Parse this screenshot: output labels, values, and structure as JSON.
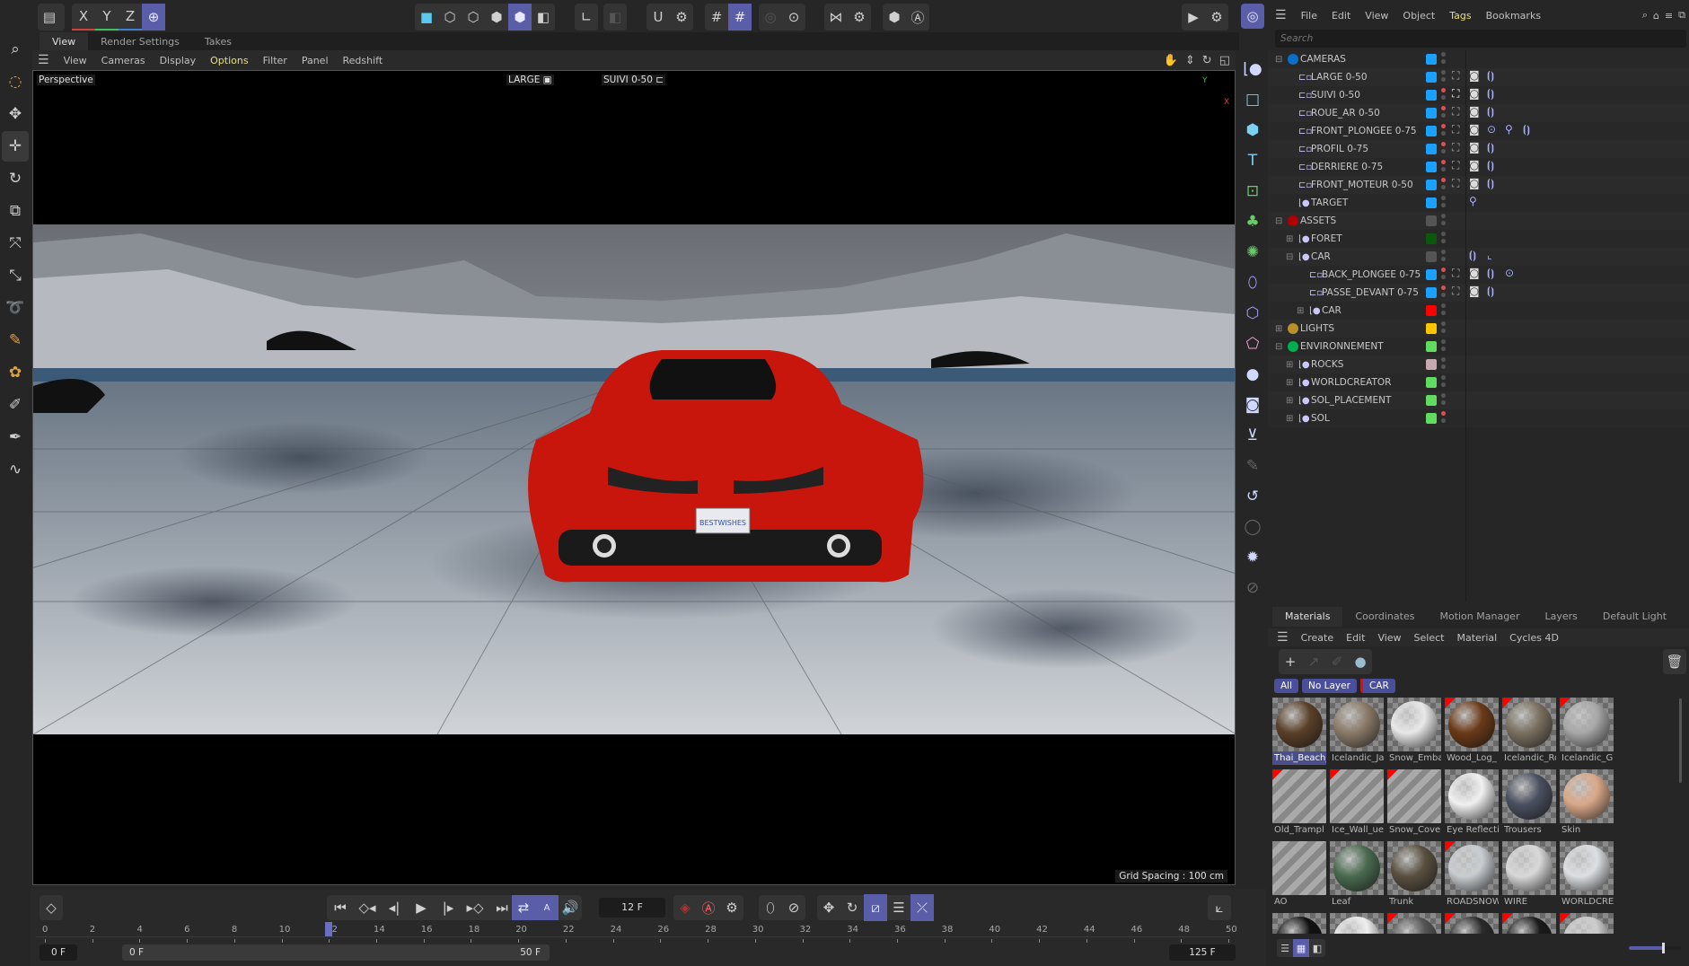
{
  "top_toolbar": {
    "axis_labels": [
      "X",
      "Y",
      "Z"
    ],
    "accent": "#5a5ea8"
  },
  "viewport": {
    "tabs": [
      "View",
      "Render Settings",
      "Takes"
    ],
    "menu": [
      "View",
      "Cameras",
      "Display",
      "Options",
      "Filter",
      "Panel",
      "Redshift"
    ],
    "active_menu": "Options",
    "label": "Perspective",
    "camera_label": "LARGE",
    "active_camera": "SUIVI 0-50",
    "grid_spacing": "Grid Spacing : 100 cm",
    "plate_text": "BESTWISHES",
    "axis_y": "Y",
    "axis_x": "X"
  },
  "object_manager": {
    "menu": [
      "File",
      "Edit",
      "View",
      "Object",
      "Tags",
      "Bookmarks"
    ],
    "active_menu": "Tags",
    "search_placeholder": "Search",
    "objects": [
      {
        "name": "CAMERAS",
        "depth": 0,
        "type": "null",
        "dot": "#0a6fc9",
        "color": "#1aa0ff",
        "expander": "minus",
        "red": false,
        "tags": []
      },
      {
        "name": "LARGE 0-50",
        "depth": 1,
        "type": "camera",
        "color": "#1aa0ff",
        "red": false,
        "tags": [
          "frame",
          "camera",
          "vibrate"
        ]
      },
      {
        "name": "SUIVI 0-50",
        "depth": 1,
        "type": "camera",
        "color": "#1aa0ff",
        "red": true,
        "tags": [
          "frame-active",
          "camera",
          "vibrate"
        ]
      },
      {
        "name": "ROUE_AR 0-50",
        "depth": 1,
        "type": "camera",
        "color": "#1aa0ff",
        "red": true,
        "tags": [
          "frame",
          "camera",
          "vibrate"
        ]
      },
      {
        "name": "FRONT_PLONGEE 0-75",
        "depth": 1,
        "type": "camera",
        "color": "#1aa0ff",
        "red": true,
        "tags": [
          "frame",
          "camera",
          "target",
          "pin",
          "vibrate"
        ]
      },
      {
        "name": "PROFIL 0-75",
        "depth": 1,
        "type": "camera",
        "color": "#1aa0ff",
        "red": true,
        "tags": [
          "frame",
          "camera",
          "vibrate"
        ]
      },
      {
        "name": "DERRIERE 0-75",
        "depth": 1,
        "type": "camera",
        "color": "#1aa0ff",
        "red": true,
        "tags": [
          "frame",
          "camera",
          "vibrate"
        ]
      },
      {
        "name": "FRONT_MOTEUR 0-50",
        "depth": 1,
        "type": "camera",
        "color": "#1aa0ff",
        "red": true,
        "tags": [
          "frame",
          "camera",
          "vibrate"
        ]
      },
      {
        "name": "TARGET",
        "depth": 1,
        "type": "null",
        "color": "#1aa0ff",
        "red": false,
        "tags": [
          "pin"
        ]
      },
      {
        "name": "ASSETS",
        "depth": 0,
        "type": "null",
        "dot": "#b00000",
        "color": "#555555",
        "expander": "minus",
        "red": false,
        "tags": []
      },
      {
        "name": "FORET",
        "depth": 1,
        "type": "null",
        "color": "#0b5a0b",
        "expander": "plus",
        "red": false,
        "tags": []
      },
      {
        "name": "CAR",
        "depth": 1,
        "type": "null",
        "color": "#555555",
        "expander": "minus",
        "red": false,
        "tags": [
          "vibrate",
          "protect"
        ]
      },
      {
        "name": "BACK_PLONGEE 0-75",
        "depth": 2,
        "type": "camera",
        "color": "#1aa0ff",
        "red": true,
        "tags": [
          "frame",
          "camera",
          "vibrate",
          "target"
        ]
      },
      {
        "name": "PASSE_DEVANT 0-75",
        "depth": 2,
        "type": "camera",
        "color": "#1aa0ff",
        "red": true,
        "tags": [
          "frame",
          "camera",
          "vibrate"
        ]
      },
      {
        "name": "CAR",
        "depth": 2,
        "type": "null",
        "color": "#ff0000",
        "expander": "plus",
        "red": false,
        "tags": []
      },
      {
        "name": "LIGHTS",
        "depth": 0,
        "type": "null",
        "dot": "#b8902a",
        "color": "#ffc400",
        "expander": "plus",
        "red": false,
        "tags": []
      },
      {
        "name": "ENVIRONNEMENT",
        "depth": 0,
        "type": "null",
        "dot": "#00b050",
        "color": "#5fdc5f",
        "expander": "minus",
        "red": false,
        "tags": []
      },
      {
        "name": "ROCKS",
        "depth": 1,
        "type": "null",
        "color": "#c8a8b0",
        "expander": "plus",
        "red": false,
        "tags": []
      },
      {
        "name": "WORLDCREATOR",
        "depth": 1,
        "type": "null",
        "color": "#5fdc5f",
        "expander": "plus",
        "red": false,
        "tags": []
      },
      {
        "name": "SOL_PLACEMENT",
        "depth": 1,
        "type": "null",
        "color": "#5fdc5f",
        "expander": "plus",
        "red": false,
        "tags": []
      },
      {
        "name": "SOL",
        "depth": 1,
        "type": "null",
        "color": "#5fdc5f",
        "expander": "plus",
        "red": true,
        "tags": []
      }
    ]
  },
  "materials": {
    "tabs": [
      "Materials",
      "Coordinates",
      "Motion Manager",
      "Layers",
      "Default Light"
    ],
    "menu": [
      "Create",
      "Edit",
      "View",
      "Select",
      "Material",
      "Cycles 4D"
    ],
    "layers": [
      "All",
      "No Layer",
      "CAR"
    ],
    "items": [
      {
        "name": "Thai_Beach_",
        "color": "#5a4028",
        "flag": false,
        "selected": true
      },
      {
        "name": "Icelandic_Ja",
        "color": "#8a7a68",
        "flag": false
      },
      {
        "name": "Snow_Emba",
        "color": "#e8e8e8",
        "flag": false
      },
      {
        "name": "Wood_Log_",
        "color": "#6a3a18",
        "flag": true
      },
      {
        "name": "Icelandic_Ro",
        "color": "#7a7060",
        "flag": true
      },
      {
        "name": "Icelandic_Gl",
        "color": "#a8a8a8",
        "flag": true
      },
      {
        "name": "Old_Trampl",
        "color": "",
        "flag": true,
        "stripe": true
      },
      {
        "name": "Ice_Wall_ue",
        "color": "",
        "flag": true,
        "stripe": true
      },
      {
        "name": "Snow_Cove",
        "color": "",
        "flag": true,
        "stripe": true
      },
      {
        "name": "Eye Reflecti",
        "color": "#f0f0f0",
        "flag": false
      },
      {
        "name": "Trousers",
        "color": "#4a5060",
        "flag": false
      },
      {
        "name": "Skin",
        "color": "#d8a888",
        "flag": false
      },
      {
        "name": "AO",
        "color": "",
        "flag": false,
        "stripe": true
      },
      {
        "name": "Leaf",
        "color": "#4a6a50",
        "flag": false
      },
      {
        "name": "Trunk",
        "color": "#5a5040",
        "flag": false
      },
      {
        "name": "ROADSNOW",
        "color": "#c8ccd0",
        "flag": true
      },
      {
        "name": "WIRE",
        "color": "#d8d8d8",
        "flag": false
      },
      {
        "name": "WORLDCRE",
        "color": "#dcdfe2",
        "flag": false
      },
      {
        "name": "",
        "color": "#111111",
        "flag": false
      },
      {
        "name": "",
        "color": "#eeeeee",
        "flag": false
      },
      {
        "name": "",
        "color": "#555555",
        "flag": true
      },
      {
        "name": "",
        "color": "#2a2a2a",
        "flag": true
      },
      {
        "name": "",
        "color": "#1a1a1a",
        "flag": true
      },
      {
        "name": "",
        "color": "#cccccc",
        "flag": true
      }
    ]
  },
  "timeline": {
    "current_frame": "12 F",
    "current_frame_value": 12,
    "ticks": [
      "0",
      "2",
      "4",
      "6",
      "8",
      "10",
      "12",
      "14",
      "16",
      "18",
      "20",
      "22",
      "24",
      "26",
      "28",
      "30",
      "32",
      "34",
      "36",
      "38",
      "40",
      "42",
      "44",
      "46",
      "48",
      "50"
    ],
    "range_start": "0 F",
    "preview_start": "0 F",
    "preview_end": "50 F",
    "range_end": "125 F"
  }
}
